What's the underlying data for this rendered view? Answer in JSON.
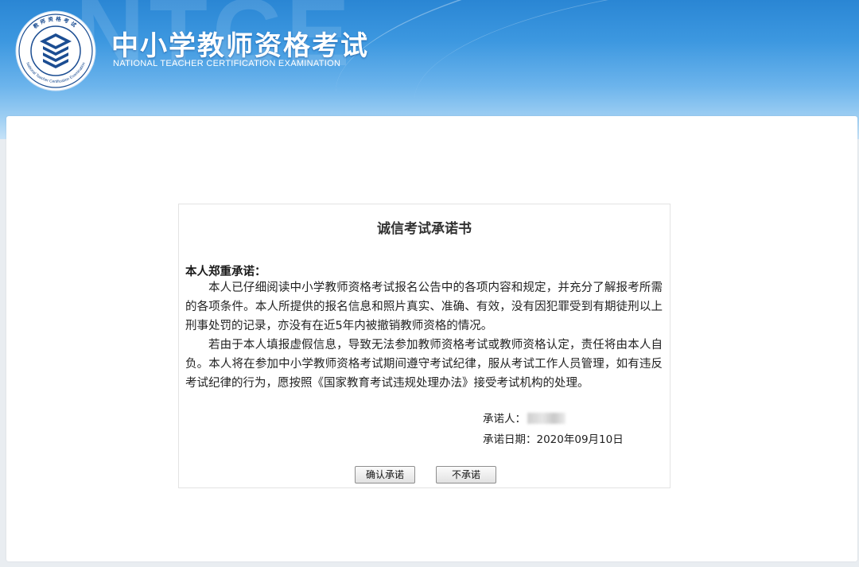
{
  "header": {
    "watermark": "NTCE",
    "title": "中小学教师资格考试",
    "subtitle": "NATIONAL TEACHER CERTIFICATION EXAMINATION",
    "logo_ring_top": "教师资格考试",
    "logo_ring_bottom": "National Teacher Certification Examination"
  },
  "pledge": {
    "title": "诚信考试承诺书",
    "lead": "本人郑重承诺：",
    "paragraphs": [
      "本人已仔细阅读中小学教师资格考试报名公告中的各项内容和规定，并充分了解报考所需的各项条件。本人所提供的报名信息和照片真实、准确、有效，没有因犯罪受到有期徒刑以上刑事处罚的记录，亦没有在近5年内被撤销教师资格的情况。",
      "若由于本人填报虚假信息，导致无法参加教师资格考试或教师资格认定，责任将由本人自负。本人将在参加中小学教师资格考试期间遵守考试纪律，服从考试工作人员管理，如有违反考试纪律的行为，愿按照《国家教育考试违规处理办法》接受考试机构的处理。"
    ],
    "signer_label": "承诺人：",
    "date_label": "承诺日期：",
    "date_value": "2020年09月10日"
  },
  "buttons": {
    "confirm": "确认承诺",
    "decline": "不承诺"
  },
  "colors": {
    "header_blue": "#2a86d4",
    "logo_navy": "#1b4d92"
  }
}
